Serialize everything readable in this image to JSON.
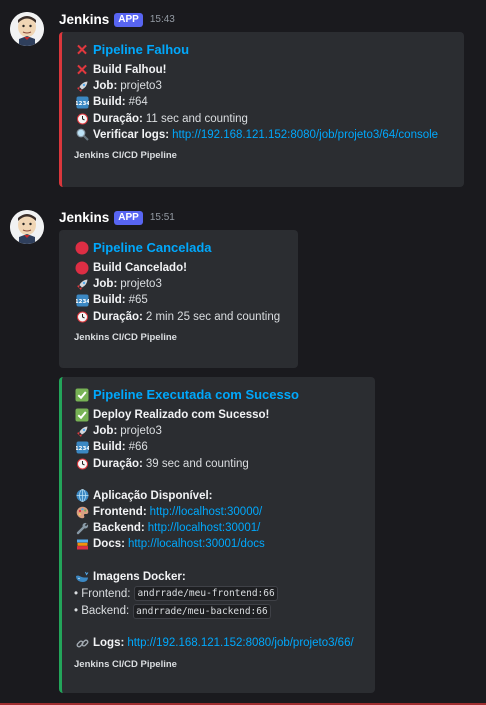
{
  "messages": [
    {
      "username": "Jenkins",
      "app_tag": "APP",
      "time": "15:43",
      "embed": {
        "title": "Pipeline Falhou",
        "heading": "Build Falhou!",
        "job_label": "Job:",
        "job": "projeto3",
        "build_label": "Build:",
        "build": "#64",
        "duration_label": "Duração:",
        "duration": "11 sec and counting",
        "logs_label": "Verificar logs:",
        "logs_url": "http://192.168.121.152:8080/job/projeto3/64/console",
        "footer": "Jenkins CI/CD Pipeline",
        "accent": "#da373c"
      }
    },
    {
      "username": "Jenkins",
      "app_tag": "APP",
      "time": "15:51",
      "embed": {
        "title": "Pipeline Cancelada",
        "heading": "Build Cancelado!",
        "job_label": "Job:",
        "job": "projeto3",
        "build_label": "Build:",
        "build": "#65",
        "duration_label": "Duração:",
        "duration": "2 min 25 sec and counting",
        "footer": "Jenkins CI/CD Pipeline"
      }
    },
    {
      "embed": {
        "title": "Pipeline Executada com Sucesso",
        "heading": "Deploy Realizado com Sucesso!",
        "job_label": "Job:",
        "job": "projeto3",
        "build_label": "Build:",
        "build": "#66",
        "duration_label": "Duração:",
        "duration": "39 sec and counting",
        "app_heading": "Aplicação Disponível:",
        "frontend_label": "Frontend:",
        "frontend_url": "http://localhost:30000/",
        "backend_label": "Backend:",
        "backend_url": "http://localhost:30001/",
        "docs_label": "Docs:",
        "docs_url": "http://localhost:30001/docs",
        "images_heading": "Imagens Docker:",
        "img_frontend_label": "• Frontend:",
        "img_frontend": "andrrade/meu-frontend:66",
        "img_backend_label": "• Backend:",
        "img_backend": "andrrade/meu-backend:66",
        "logs_label": "Logs:",
        "logs_url": "http://192.168.121.152:8080/job/projeto3/66/",
        "footer": "Jenkins CI/CD Pipeline",
        "accent": "#23a55a"
      }
    }
  ],
  "icons": {
    "fail": "cross-mark-icon",
    "cancel": "stop-sign-icon",
    "success": "check-mark-icon",
    "job": "rocket-icon",
    "build": "numbers-icon",
    "duration": "alarm-clock-icon",
    "logs": "magnifier-icon",
    "app": "globe-icon",
    "frontend": "palette-icon",
    "backend": "wrench-icon",
    "docs": "books-icon",
    "docker": "whale-icon",
    "link": "link-icon"
  }
}
